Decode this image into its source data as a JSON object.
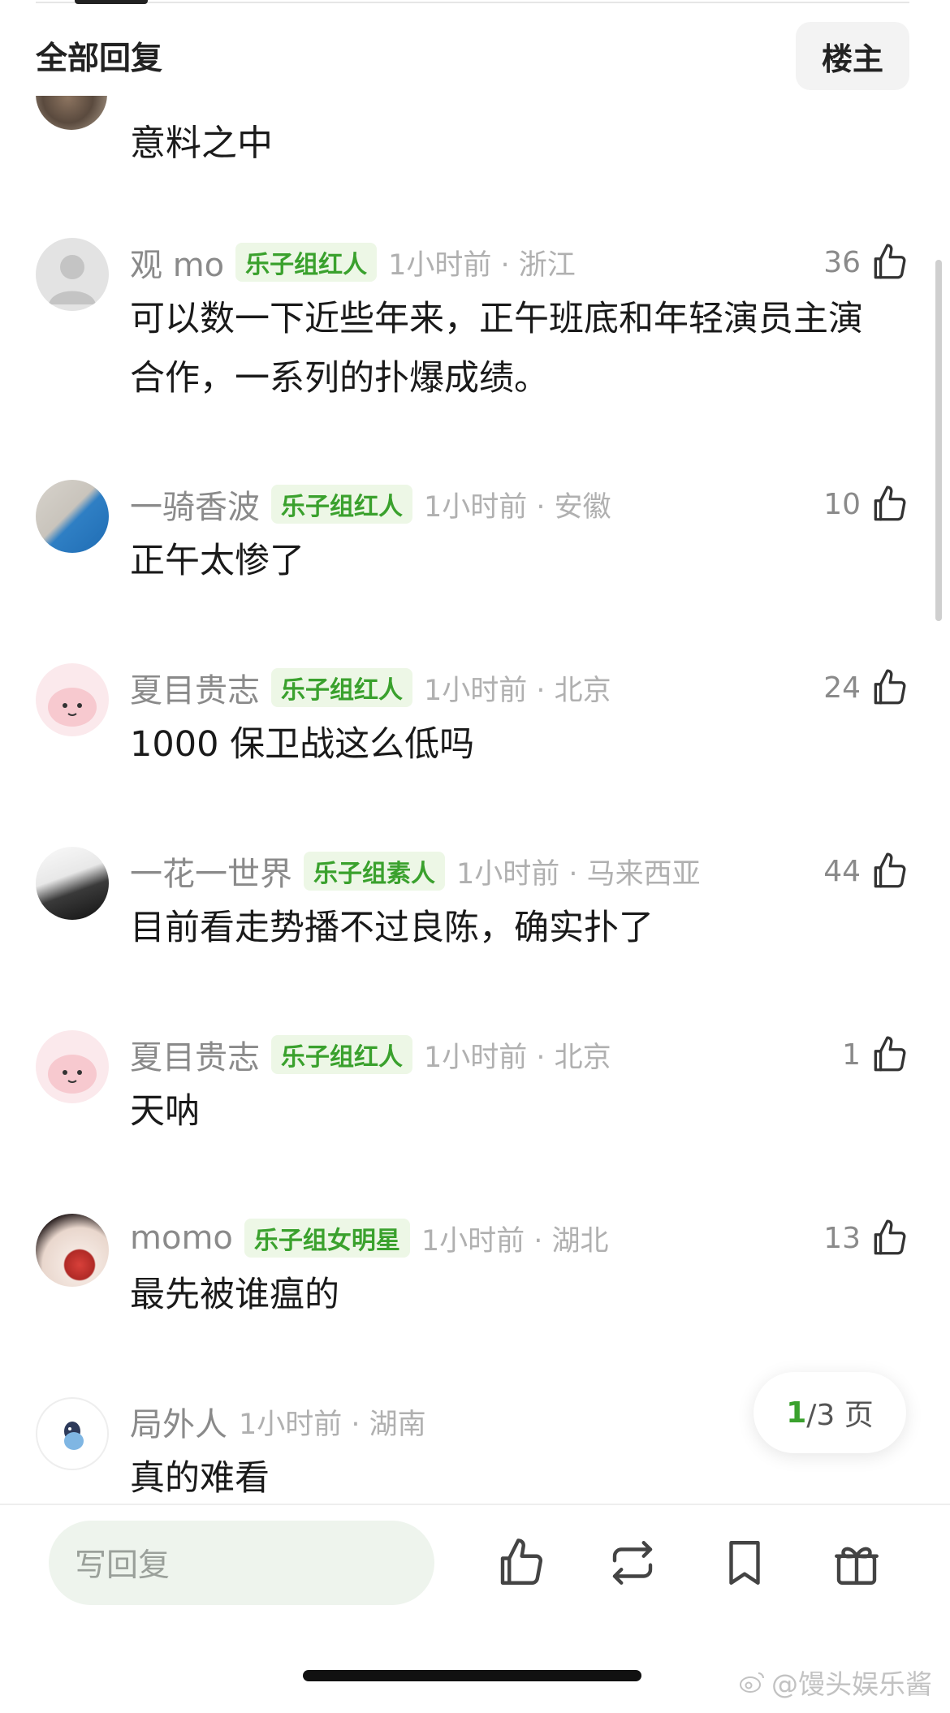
{
  "header": {
    "title": "全部回复",
    "owner_button": "楼主"
  },
  "partial_comment": {
    "text": "意料之中"
  },
  "comments": [
    {
      "username": "观 mo",
      "badge": "乐子组红人",
      "time_location": "1小时前 · 浙江",
      "likes": "36",
      "text": "可以数一下近些年来，正午班底和年轻演员主演合作，一系列的扑爆成绩。"
    },
    {
      "username": "一骑香波",
      "badge": "乐子组红人",
      "time_location": "1小时前 · 安徽",
      "likes": "10",
      "text": "正午太惨了"
    },
    {
      "username": "夏目贵志",
      "badge": "乐子组红人",
      "time_location": "1小时前 · 北京",
      "likes": "24",
      "text": "1000 保卫战这么低吗"
    },
    {
      "username": "一花一世界",
      "badge": "乐子组素人",
      "time_location": "1小时前 · 马来西亚",
      "likes": "44",
      "text": "目前看走势播不过良陈，确实扑了"
    },
    {
      "username": "夏目贵志",
      "badge": "乐子组红人",
      "time_location": "1小时前 · 北京",
      "likes": "1",
      "text": "天呐"
    },
    {
      "username": "momo",
      "badge": "乐子组女明星",
      "time_location": "1小时前 · 湖北",
      "likes": "13",
      "text": "最先被谁瘟的"
    },
    {
      "username": "局外人",
      "badge": "",
      "time_location": "1小时前 · 湖南",
      "likes": "",
      "text": "真的难看"
    }
  ],
  "pager": {
    "current": "1",
    "total_label": "/3 页"
  },
  "bottom_bar": {
    "reply_placeholder": "写回复"
  },
  "watermark": "@馒头娱乐酱",
  "colors": {
    "badge_text": "#3aa12d",
    "badge_bg": "#edf7e6",
    "reply_bg": "#eef4ed"
  }
}
